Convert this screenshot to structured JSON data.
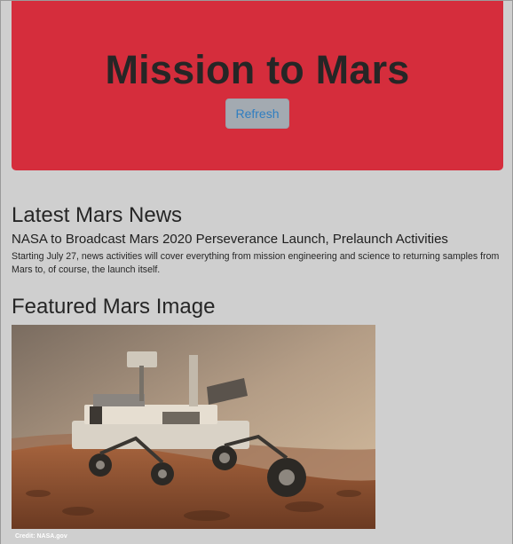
{
  "header": {
    "title": "Mission to Mars",
    "refresh_label": "Refresh"
  },
  "news": {
    "heading": "Latest Mars News",
    "title": "NASA to Broadcast Mars 2020 Perseverance Launch, Prelaunch Activities",
    "paragraph": "Starting July 27, news activities will cover everything from mission engineering and science to returning samples from Mars to, of course, the launch itself."
  },
  "featured": {
    "heading": "Featured Mars Image",
    "credit": "Credit: NASA.gov"
  },
  "colors": {
    "page_bg": "#cfcfcf",
    "hero_bg": "#d52d3c",
    "button_bg": "#a3aab1",
    "button_text": "#2f7ec1"
  }
}
